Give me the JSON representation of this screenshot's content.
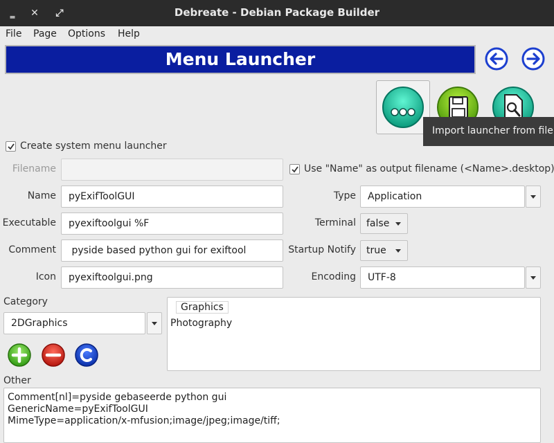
{
  "window": {
    "title": "Debreate - Debian Package Builder",
    "minimize_glyph": "‗",
    "close_glyph": "✕",
    "maximize_glyph": "⤢"
  },
  "menubar": [
    "File",
    "Page",
    "Options",
    "Help"
  ],
  "banner": {
    "title": "Menu Launcher",
    "color": "#0a1ea0"
  },
  "tooltip": "Import launcher from file",
  "create_launcher": {
    "label": "Create system menu launcher",
    "checked": true
  },
  "filename": {
    "label": "Filename",
    "value": ""
  },
  "use_name_output": {
    "label": "Use \"Name\" as output filename (<Name>.desktop)",
    "checked": true
  },
  "name": {
    "label": "Name",
    "value": "pyExifToolGUI"
  },
  "executable": {
    "label": "Executable",
    "value": "pyexiftoolgui %F"
  },
  "comment": {
    "label": "Comment",
    "value": " pyside based python gui for exiftool"
  },
  "icon": {
    "label": "Icon",
    "value": "pyexiftoolgui.png"
  },
  "type": {
    "label": "Type",
    "value": "Application"
  },
  "terminal": {
    "label": "Terminal",
    "value": "false"
  },
  "startup_notify": {
    "label": "Startup Notify",
    "value": "true"
  },
  "encoding": {
    "label": "Encoding",
    "value": "UTF-8"
  },
  "category": {
    "label": "Category",
    "value": "2DGraphics",
    "list": [
      "Graphics",
      "Photography"
    ]
  },
  "other": {
    "label": "Other",
    "lines": [
      "Comment[nl]=pyside gebaseerde python gui",
      "GenericName=pyExifToolGUI",
      "MimeType=application/x-mfusion;image/jpeg;image/tiff;"
    ]
  },
  "icons": {
    "back": "arrow-left-icon",
    "forward": "arrow-right-icon",
    "options": "more-options-icon",
    "save": "floppy-save-icon",
    "import": "file-search-icon",
    "add": "plus-icon",
    "remove": "minus-icon",
    "clear": "clear-icon"
  }
}
